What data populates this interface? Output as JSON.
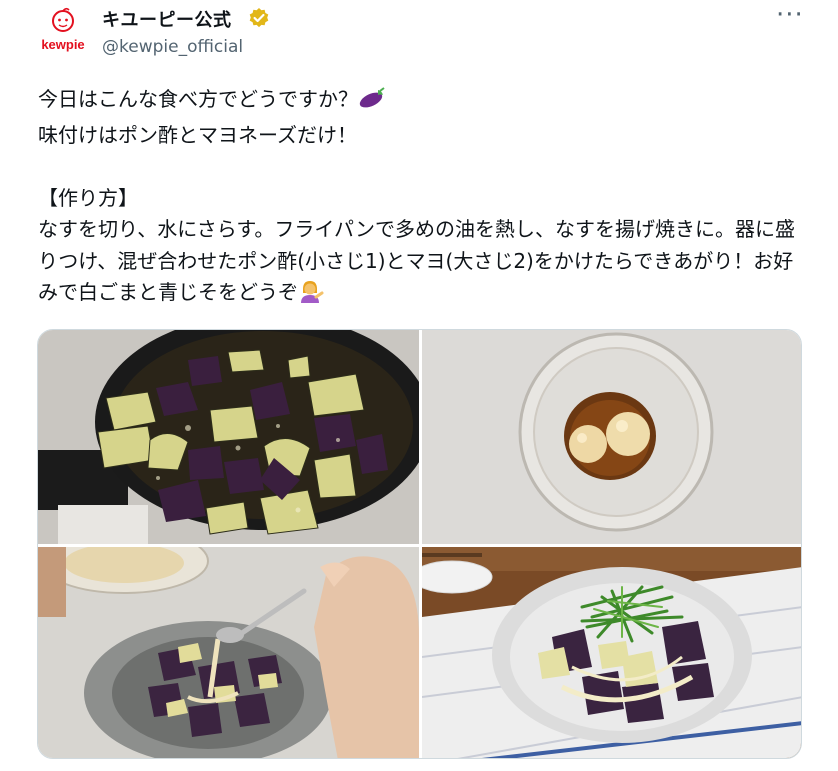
{
  "account": {
    "display_name": "キユーピー公式",
    "handle": "@kewpie_official",
    "logo_text": "kewpie",
    "verified_badge_icon": "verified-badge-icon"
  },
  "menu": {
    "more_label": "···"
  },
  "post": {
    "line1": "今日はこんな食べ方でどうですか？",
    "line1_emoji": "eggplant-emoji",
    "line2": "味付けはポン酢とマヨネーズだけ！",
    "heading": "【作り方】",
    "instructions": "なすを切り、水にさらす。フライパンで多めの油を熱し、なすを揚げ焼きに。器に盛りつけ、混ぜ合わせたポン酢(小さじ1)とマヨ(大さじ2)をかけたらできあがり！お好みで白ごまと青じそをどうぞ",
    "instructions_emoji": "person-tipping-hand-emoji"
  },
  "media": [
    {
      "name": "frying-eggplant-photo",
      "description_icon": "frying-pan"
    },
    {
      "name": "ponzu-mayo-bowl-photo",
      "description_icon": "glass-bowl"
    },
    {
      "name": "pouring-sauce-photo",
      "description_icon": "spoon"
    },
    {
      "name": "finished-dish-photo",
      "description_icon": "plate"
    }
  ],
  "colors": {
    "brand_red": "#e3101f",
    "verified_gold": "#e2b719",
    "text_primary": "#0f1419",
    "text_secondary": "#536471",
    "border": "#cfd9de"
  }
}
